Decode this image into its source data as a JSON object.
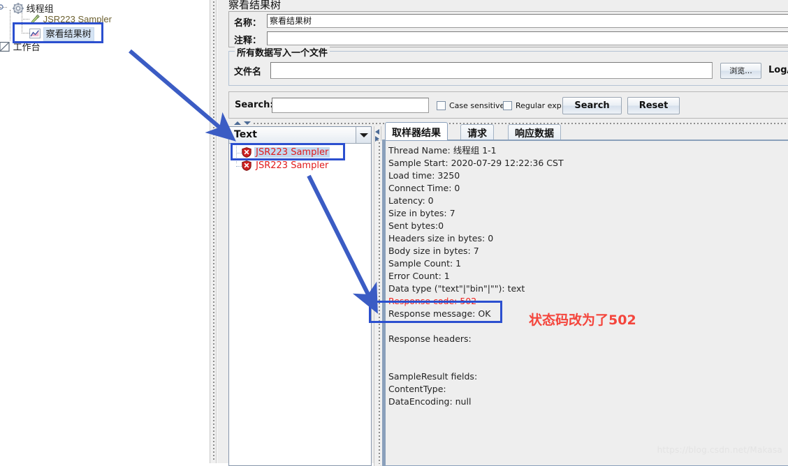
{
  "left_tree": {
    "items": [
      {
        "label": "线程组",
        "icon": "gear-icon"
      },
      {
        "label": "JSR223 Sampler",
        "icon": "test-tube-icon"
      },
      {
        "label": "察看结果树",
        "icon": "results-tree-icon"
      },
      {
        "label": "工作台",
        "icon": "workbench-icon"
      }
    ]
  },
  "panel": {
    "title": "察看结果树",
    "name_label": "名称：",
    "name_value": "察看结果树",
    "comment_label": "注释：",
    "comment_value": ""
  },
  "file_group": {
    "title": "所有数据写入一个文件",
    "filename_label": "文件名",
    "filename_value": "",
    "browse_button": "浏览...",
    "log_display_label": "Log/Di"
  },
  "search": {
    "label": "Search:",
    "value": "",
    "case_sensitive_label": "Case sensitive",
    "regular_exp_label": "Regular exp.",
    "search_button": "Search",
    "reset_button": "Reset"
  },
  "renderer": {
    "selected": "Text"
  },
  "results": [
    {
      "label": "JSR223 Sampler",
      "status": "error",
      "selected": true
    },
    {
      "label": "JSR223 Sampler",
      "status": "error",
      "selected": false
    }
  ],
  "tabs": [
    {
      "label": "取样器结果",
      "active": true
    },
    {
      "label": "请求",
      "active": false
    },
    {
      "label": "响应数据",
      "active": false
    }
  ],
  "sampler_result": {
    "lines": [
      {
        "text": "Thread Name: 线程组 1-1",
        "error": false
      },
      {
        "text": "Sample Start: 2020-07-29 12:22:36 CST",
        "error": false
      },
      {
        "text": "Load time: 3250",
        "error": false
      },
      {
        "text": "Connect Time: 0",
        "error": false
      },
      {
        "text": "Latency: 0",
        "error": false
      },
      {
        "text": "Size in bytes: 7",
        "error": false
      },
      {
        "text": "Sent bytes:0",
        "error": false
      },
      {
        "text": "Headers size in bytes: 0",
        "error": false
      },
      {
        "text": "Body size in bytes: 7",
        "error": false
      },
      {
        "text": "Sample Count: 1",
        "error": false
      },
      {
        "text": "Error Count: 1",
        "error": false
      },
      {
        "text": "Data type (\"text\"|\"bin\"|\"\"): text",
        "error": false
      },
      {
        "text": "Response code: 502",
        "error": true
      },
      {
        "text": "Response message: OK",
        "error": false
      },
      {
        "text": "",
        "error": false
      },
      {
        "text": "Response headers:",
        "error": false
      },
      {
        "text": "",
        "error": false
      },
      {
        "text": "",
        "error": false
      },
      {
        "text": "SampleResult fields:",
        "error": false
      },
      {
        "text": "ContentType:",
        "error": false
      },
      {
        "text": "DataEncoding: null",
        "error": false
      }
    ]
  },
  "annotations": {
    "note_text": "状态码改为了502",
    "note_color": "#f4453c",
    "box_color": "#2b4fcf",
    "arrow_color": "#3b5cc4"
  },
  "watermark": "https://blog.csdn.net/Makasa"
}
